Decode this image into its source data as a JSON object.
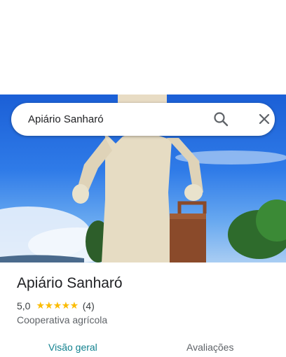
{
  "search": {
    "query": "Apiário Sanharó",
    "search_icon": "search-icon",
    "close_icon": "close-icon"
  },
  "place": {
    "name": "Apiário Sanharó",
    "rating": "5,0",
    "stars": "★★★★★",
    "review_count": "(4)",
    "category": "Cooperativa agrícola"
  },
  "tabs": [
    {
      "label": "Visão geral",
      "active": true
    },
    {
      "label": "Avaliações",
      "active": false
    }
  ],
  "colors": {
    "accent": "#11818f",
    "star": "#fbbc04",
    "sky": "#2f7be8"
  }
}
